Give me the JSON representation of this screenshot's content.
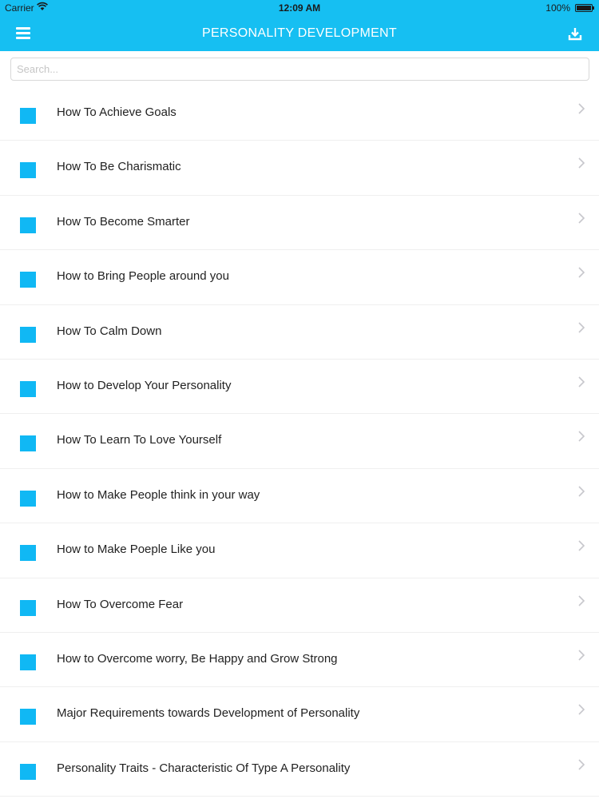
{
  "status_bar": {
    "carrier": "Carrier",
    "time": "12:09 AM",
    "battery": "100%"
  },
  "nav": {
    "title": "PERSONALITY DEVELOPMENT",
    "left_icon": "hamburger-menu-icon",
    "right_icon": "download-icon"
  },
  "search": {
    "placeholder": "Search...",
    "value": ""
  },
  "colors": {
    "accent": "#16bff2",
    "item_square": "#10b8f4"
  },
  "items": [
    {
      "label": "How To Achieve Goals"
    },
    {
      "label": "How To Be Charismatic"
    },
    {
      "label": "How To Become Smarter"
    },
    {
      "label": "How to Bring People around you"
    },
    {
      "label": "How To Calm Down"
    },
    {
      "label": "How to Develop Your Personality"
    },
    {
      "label": "How To Learn To Love Yourself"
    },
    {
      "label": "How to Make People think in your way"
    },
    {
      "label": "How to Make Poeple Like you"
    },
    {
      "label": "How To Overcome Fear"
    },
    {
      "label": "How to Overcome worry, Be Happy and Grow Strong"
    },
    {
      "label": "Major Requirements towards Development of Personality"
    },
    {
      "label": "Personality Traits - Characteristic Of Type A Personality"
    }
  ]
}
